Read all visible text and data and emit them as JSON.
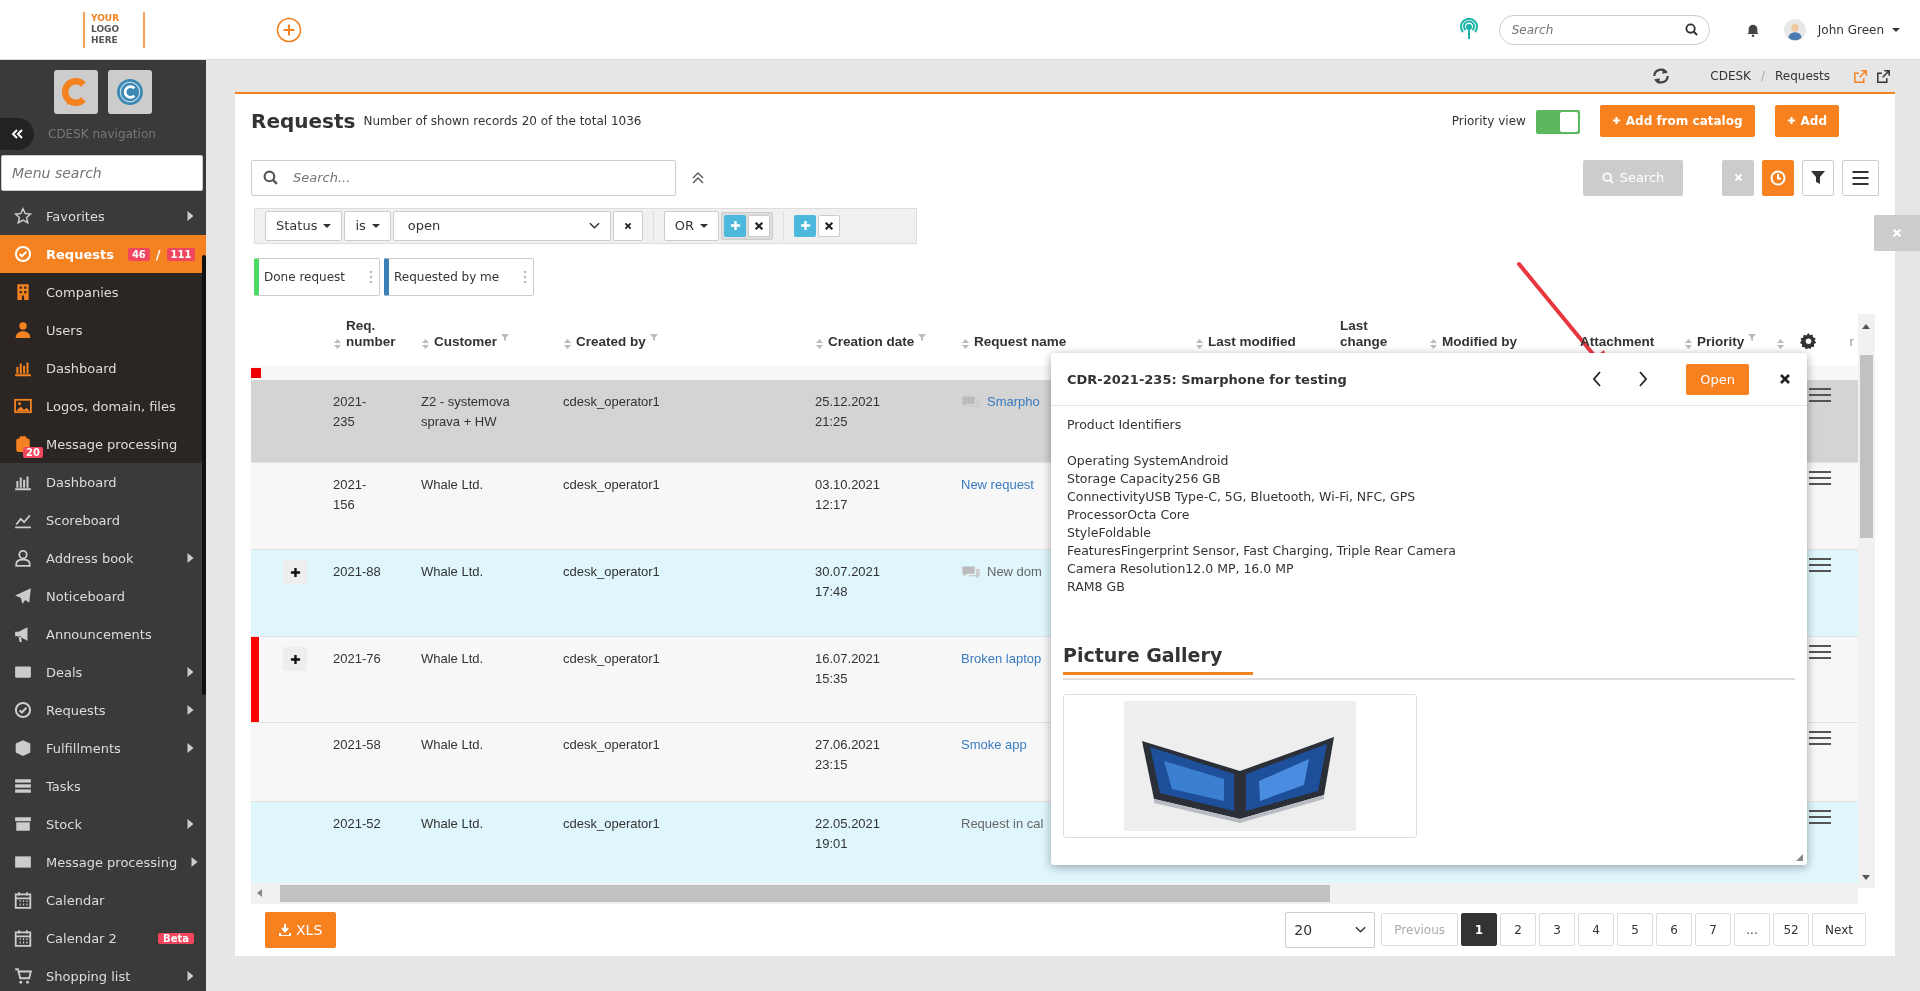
{
  "header": {
    "logo": [
      "YOUR",
      "LOGO",
      "HERE"
    ],
    "search": {
      "placeholder": "Search"
    },
    "user": "John Green"
  },
  "sidebar": {
    "nav_title": "CDESK navigation",
    "search_placeholder": "Menu search",
    "items": [
      {
        "label": "Favorites",
        "nested": false,
        "submenu": true,
        "selected": false
      },
      {
        "label": "Requests",
        "nested": true,
        "submenu": false,
        "selected": true,
        "badges": [
          "46",
          "111"
        ],
        "separator": "/"
      },
      {
        "label": "Companies",
        "nested": true,
        "submenu": false,
        "selected": false
      },
      {
        "label": "Users",
        "nested": true,
        "submenu": false,
        "selected": false
      },
      {
        "label": "Dashboard",
        "nested": true,
        "submenu": false,
        "selected": false
      },
      {
        "label": "Logos, domain, files",
        "nested": true,
        "submenu": false,
        "selected": false
      },
      {
        "label": "Message processing",
        "nested": true,
        "submenu": false,
        "selected": false,
        "count": "20"
      },
      {
        "label": "Dashboard",
        "nested": false,
        "submenu": false,
        "selected": false
      },
      {
        "label": "Scoreboard",
        "nested": false,
        "submenu": false,
        "selected": false
      },
      {
        "label": "Address book",
        "nested": false,
        "submenu": true,
        "selected": false
      },
      {
        "label": "Noticeboard",
        "nested": false,
        "submenu": false,
        "selected": false
      },
      {
        "label": "Announcements",
        "nested": false,
        "submenu": false,
        "selected": false
      },
      {
        "label": "Deals",
        "nested": false,
        "submenu": true,
        "selected": false
      },
      {
        "label": "Requests",
        "nested": false,
        "submenu": true,
        "selected": false
      },
      {
        "label": "Fulfillments",
        "nested": false,
        "submenu": true,
        "selected": false
      },
      {
        "label": "Tasks",
        "nested": false,
        "submenu": false,
        "selected": false
      },
      {
        "label": "Stock",
        "nested": false,
        "submenu": true,
        "selected": false
      },
      {
        "label": "Message processing",
        "nested": false,
        "submenu": true,
        "selected": false
      },
      {
        "label": "Calendar",
        "nested": false,
        "submenu": false,
        "selected": false
      },
      {
        "label": "Calendar 2",
        "nested": false,
        "submenu": false,
        "selected": false,
        "tag": "Beta"
      },
      {
        "label": "Shopping list",
        "nested": false,
        "submenu": true,
        "selected": false
      }
    ]
  },
  "breadcrumb": {
    "items": [
      "CDESK",
      "Requests"
    ],
    "separator": "/"
  },
  "page": {
    "title": "Requests",
    "subtitle": "Number of shown records 20 of the total 1036",
    "priority_view": {
      "label": "Priority view",
      "on": true
    },
    "buttons": [
      "Add from catalog",
      "Add"
    ],
    "search_placeholder": "Search...",
    "search_button": "Search"
  },
  "filter": {
    "field": "Status",
    "operator": "is",
    "value": "open",
    "join": "OR"
  },
  "saved_filters": [
    {
      "label": "Done request",
      "color": "#4cd964"
    },
    {
      "label": "Requested by me",
      "color": "#3b7fb6"
    }
  ],
  "table": {
    "columns": [
      {
        "label": "Req. number",
        "sortable": true,
        "filterable": false
      },
      {
        "label": "Customer",
        "sortable": true,
        "filterable": true
      },
      {
        "label": "Created by",
        "sortable": true,
        "filterable": true
      },
      {
        "label": "Creation date",
        "sortable": true,
        "filterable": true
      },
      {
        "label": "Request name",
        "sortable": true,
        "filterable": false
      },
      {
        "label": "Last modified",
        "sortable": true,
        "filterable": false
      },
      {
        "label": "Last change",
        "sortable": false,
        "filterable": false
      },
      {
        "label": "Modified by",
        "sortable": true,
        "filterable": false
      },
      {
        "label": "Attachment",
        "sortable": false,
        "filterable": false
      },
      {
        "label": "Priority",
        "sortable": true,
        "filterable": true
      }
    ],
    "column_12": "r",
    "rows": [
      {
        "number": "2021-235",
        "customer": "Z2 - systemova sprava + HW",
        "created_by": "cdesk_operator1",
        "created": "25.12.2021 21:25",
        "name": "Smarpho",
        "linked": true,
        "comments": true,
        "expandable": false,
        "flagged": false,
        "selected": true
      },
      {
        "number": "2021-156",
        "customer": "Whale Ltd.",
        "created_by": "cdesk_operator1",
        "created": "03.10.2021 12:17",
        "name": "New request",
        "linked": true,
        "comments": false,
        "expandable": false,
        "flagged": false,
        "selected": false,
        "color": "#f7f7f7"
      },
      {
        "number": "2021-88",
        "customer": "Whale Ltd.",
        "created_by": "cdesk_operator1",
        "created": "30.07.2021 17:48",
        "name": "New dom",
        "linked": false,
        "comments": true,
        "expandable": true,
        "flagged": false,
        "selected": false,
        "color": "#dff6fd"
      },
      {
        "number": "2021-76",
        "customer": "Whale Ltd.",
        "created_by": "cdesk_operator1",
        "created": "16.07.2021 15:35",
        "name": "Broken laptop",
        "linked": true,
        "comments": false,
        "expandable": true,
        "flagged": true,
        "selected": false,
        "color": "#f7f7f7"
      },
      {
        "number": "2021-58",
        "customer": "Whale Ltd.",
        "created_by": "cdesk_operator1",
        "created": "27.06.2021 23:15",
        "name": "Smoke app",
        "linked": true,
        "comments": false,
        "expandable": false,
        "flagged": false,
        "selected": false,
        "color": "#f7f7f7"
      },
      {
        "number": "2021-52",
        "customer": "Whale Ltd.",
        "created_by": "cdesk_operator1",
        "created": "22.05.2021 19:01",
        "name": "Request in cal",
        "linked": false,
        "comments": false,
        "expandable": false,
        "flagged": false,
        "selected": false,
        "color": "#dff6fd"
      }
    ]
  },
  "footer": {
    "export": "XLS",
    "per_page": "20",
    "pages": [
      {
        "label": "Previous",
        "selected": false,
        "disabled": true
      },
      {
        "label": "1",
        "selected": true,
        "disabled": false
      },
      {
        "label": "2",
        "selected": false,
        "disabled": false
      },
      {
        "label": "3",
        "selected": false,
        "disabled": false
      },
      {
        "label": "4",
        "selected": false,
        "disabled": false
      },
      {
        "label": "5",
        "selected": false,
        "disabled": false
      },
      {
        "label": "6",
        "selected": false,
        "disabled": false
      },
      {
        "label": "7",
        "selected": false,
        "disabled": false
      },
      {
        "label": "...",
        "selected": false,
        "disabled": false
      },
      {
        "label": "52",
        "selected": false,
        "disabled": false
      },
      {
        "label": "Next",
        "selected": false,
        "disabled": false
      }
    ]
  },
  "popup": {
    "title": "CDR-2021-235: Smarphone for testing",
    "open": "Open",
    "intro": "Product Identifiers",
    "specs": [
      "Operating SystemAndroid",
      "Storage Capacity256 GB",
      "ConnectivityUSB Type-C, 5G, Bluetooth, Wi-Fi, NFC, GPS",
      "ProcessorOcta Core",
      "StyleFoldable",
      "FeaturesFingerprint Sensor, Fast Charging, Triple Rear Camera",
      "Camera Resolution12.0 MP, 16.0 MP",
      "RAM8 GB"
    ],
    "gallery_title": "Picture Gallery"
  }
}
